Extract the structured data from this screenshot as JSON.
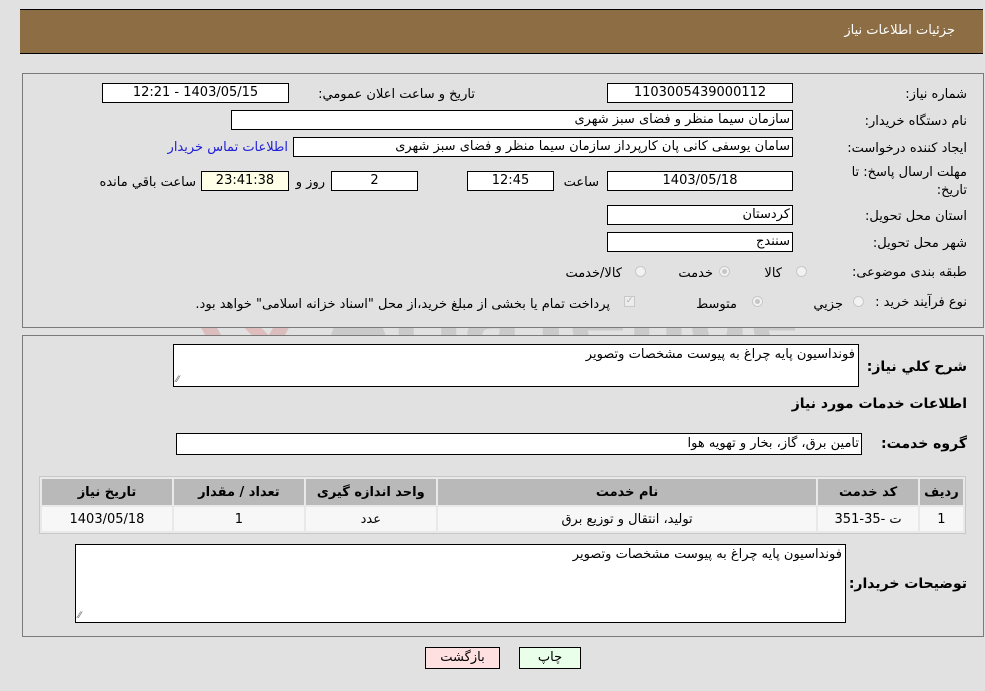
{
  "header": {
    "title": "جزئیات اطلاعات نیاز"
  },
  "form": {
    "need_number": {
      "label": "شماره نیاز:",
      "value": "1103005439000112"
    },
    "announce_datetime": {
      "label": "تاریخ و ساعت اعلان عمومي:",
      "value": "1403/05/15 - 12:21"
    },
    "buyer_org": {
      "label": "نام دستگاه خریدار:",
      "value": "سازمان سیما  منظر و فضای سبز شهری"
    },
    "requester": {
      "label": "ایجاد کننده درخواست:",
      "value": "سامان یوسفی کانی پان کارپرداز سازمان سیما  منظر و فضای سبز شهری"
    },
    "contact_link": "اطلاعات تماس خریدار",
    "deadline": {
      "label_line1": "مهلت ارسال پاسخ: تا",
      "label_line2": "تاریخ:",
      "date": "1403/05/18",
      "time_label": "ساعت",
      "time": "12:45",
      "days": "2",
      "days_label": "روز و",
      "remaining": "23:41:38",
      "remaining_label": "ساعت باقي مانده"
    },
    "province": {
      "label": "استان محل تحویل:",
      "value": "کردستان"
    },
    "city": {
      "label": "شهر محل تحویل:",
      "value": "سنندج"
    },
    "category": {
      "label": "طبقه بندی موضوعی:",
      "options": [
        "کالا",
        "خدمت",
        "کالا/خدمت"
      ],
      "selected": "خدمت"
    },
    "purchase_type": {
      "label": "نوع فرآیند خرید :",
      "options": [
        "جزيي",
        "متوسط"
      ],
      "selected": "متوسط",
      "treasury_checkbox_label": "پرداخت تمام یا بخشی از مبلغ خرید،از محل \"اسناد خزانه اسلامی\" خواهد بود.",
      "treasury_checked": true
    }
  },
  "details": {
    "general_desc": {
      "label": "شرح کلي نیاز:",
      "value": "فونداسیون پایه چراغ به پیوست مشخصات وتصویر"
    },
    "services_title": "اطلاعات خدمات مورد نیاز",
    "service_group": {
      "label": "گروه خدمت:",
      "value": "تامین برق، گاز، بخار و تهویه هوا"
    },
    "table": {
      "headers": [
        "ردیف",
        "کد خدمت",
        "نام خدمت",
        "واحد اندازه گیری",
        "تعداد / مقدار",
        "تاریخ نیاز"
      ],
      "rows": [
        [
          "1",
          "ت -35-351",
          "تولید، انتقال و توزیع برق",
          "عدد",
          "1",
          "1403/05/18"
        ]
      ]
    },
    "buyer_notes": {
      "label": "توضیحات خریدار:",
      "value": "فونداسیون پایه چراغ به پیوست مشخصات وتصویر"
    }
  },
  "buttons": {
    "print": "چاپ",
    "back": "بازگشت"
  },
  "colors": {
    "header_bg": "#8c6d44",
    "print_bg": "#eaffea",
    "back_bg": "#ffe0e0",
    "link": "#2020d8"
  },
  "watermark": "AriaTender.neT"
}
